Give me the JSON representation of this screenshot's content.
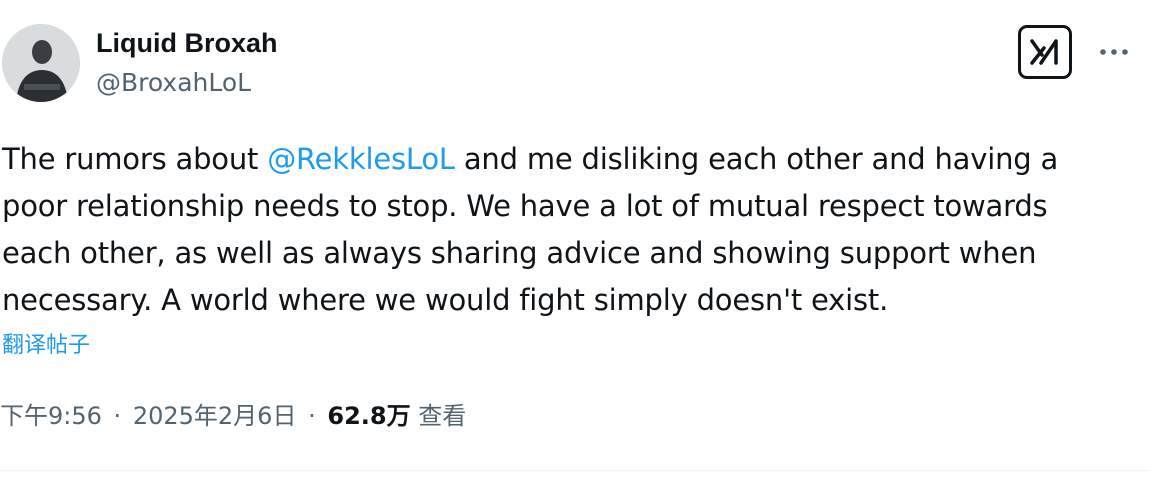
{
  "author": {
    "display_name": "Liquid Broxah",
    "handle": "@BroxahLoL"
  },
  "tweet": {
    "line1_before": "The rumors about ",
    "mention": "@RekklesLoL",
    "line1_after": " and me disliking each other and having a",
    "line2": "poor relationship needs to stop. We have a lot of mutual respect towards",
    "line3": "each other, as well as always sharing advice and showing support when",
    "line4": "necessary. A world where we would fight simply doesn't exist."
  },
  "translate_label": "翻译帖子",
  "meta": {
    "time": "下午9:56",
    "separator": "·",
    "date": "2025年2月6日",
    "views_count": "62.8万",
    "views_label": "查看"
  },
  "icons": {
    "avatar": "avatar",
    "grok": "grok-icon",
    "more": "more-icon"
  },
  "colors": {
    "link": "#1d9bf0",
    "text": "#0f1419",
    "secondary": "#536471"
  }
}
